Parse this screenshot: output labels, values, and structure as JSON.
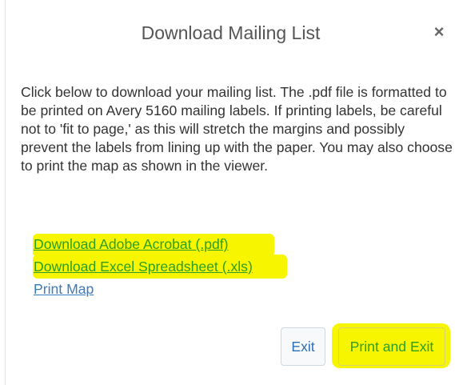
{
  "dialog": {
    "title": "Download Mailing List",
    "close_icon": "×",
    "body_text": "Click below to download your mailing list. The .pdf file is formatted to be printed on Avery 5160 mailing labels. If printing labels, be careful not to 'fit to page,' as this will stretch the margins and possibly prevent the labels from lining up with the paper. You may also choose to print the map as shown in the viewer.",
    "links": [
      {
        "label": "Download Adobe Acrobat (.pdf)"
      },
      {
        "label": "Download Excel Spreadsheet (.xls)"
      },
      {
        "label": "Print Map"
      }
    ],
    "buttons": {
      "exit_label": "Exit",
      "print_exit_label": "Print and Exit"
    },
    "colors": {
      "highlight": "#f7f600",
      "link": "#3a7abf",
      "highlighted_text": "#2f9e1f",
      "title_text": "#555555",
      "body_text": "#333333"
    }
  }
}
